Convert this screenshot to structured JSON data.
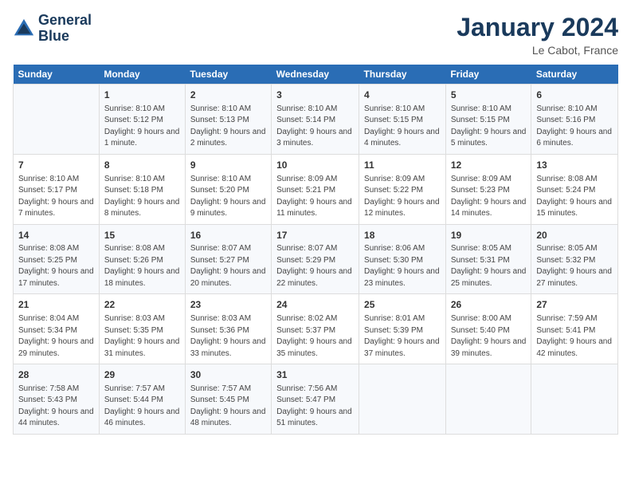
{
  "header": {
    "logo_line1": "General",
    "logo_line2": "Blue",
    "month": "January 2024",
    "location": "Le Cabot, France"
  },
  "weekdays": [
    "Sunday",
    "Monday",
    "Tuesday",
    "Wednesday",
    "Thursday",
    "Friday",
    "Saturday"
  ],
  "weeks": [
    [
      {
        "day": "",
        "sunrise": "",
        "sunset": "",
        "daylight": ""
      },
      {
        "day": "1",
        "sunrise": "Sunrise: 8:10 AM",
        "sunset": "Sunset: 5:12 PM",
        "daylight": "Daylight: 9 hours and 1 minute."
      },
      {
        "day": "2",
        "sunrise": "Sunrise: 8:10 AM",
        "sunset": "Sunset: 5:13 PM",
        "daylight": "Daylight: 9 hours and 2 minutes."
      },
      {
        "day": "3",
        "sunrise": "Sunrise: 8:10 AM",
        "sunset": "Sunset: 5:14 PM",
        "daylight": "Daylight: 9 hours and 3 minutes."
      },
      {
        "day": "4",
        "sunrise": "Sunrise: 8:10 AM",
        "sunset": "Sunset: 5:15 PM",
        "daylight": "Daylight: 9 hours and 4 minutes."
      },
      {
        "day": "5",
        "sunrise": "Sunrise: 8:10 AM",
        "sunset": "Sunset: 5:15 PM",
        "daylight": "Daylight: 9 hours and 5 minutes."
      },
      {
        "day": "6",
        "sunrise": "Sunrise: 8:10 AM",
        "sunset": "Sunset: 5:16 PM",
        "daylight": "Daylight: 9 hours and 6 minutes."
      }
    ],
    [
      {
        "day": "7",
        "sunrise": "Sunrise: 8:10 AM",
        "sunset": "Sunset: 5:17 PM",
        "daylight": "Daylight: 9 hours and 7 minutes."
      },
      {
        "day": "8",
        "sunrise": "Sunrise: 8:10 AM",
        "sunset": "Sunset: 5:18 PM",
        "daylight": "Daylight: 9 hours and 8 minutes."
      },
      {
        "day": "9",
        "sunrise": "Sunrise: 8:10 AM",
        "sunset": "Sunset: 5:20 PM",
        "daylight": "Daylight: 9 hours and 9 minutes."
      },
      {
        "day": "10",
        "sunrise": "Sunrise: 8:09 AM",
        "sunset": "Sunset: 5:21 PM",
        "daylight": "Daylight: 9 hours and 11 minutes."
      },
      {
        "day": "11",
        "sunrise": "Sunrise: 8:09 AM",
        "sunset": "Sunset: 5:22 PM",
        "daylight": "Daylight: 9 hours and 12 minutes."
      },
      {
        "day": "12",
        "sunrise": "Sunrise: 8:09 AM",
        "sunset": "Sunset: 5:23 PM",
        "daylight": "Daylight: 9 hours and 14 minutes."
      },
      {
        "day": "13",
        "sunrise": "Sunrise: 8:08 AM",
        "sunset": "Sunset: 5:24 PM",
        "daylight": "Daylight: 9 hours and 15 minutes."
      }
    ],
    [
      {
        "day": "14",
        "sunrise": "Sunrise: 8:08 AM",
        "sunset": "Sunset: 5:25 PM",
        "daylight": "Daylight: 9 hours and 17 minutes."
      },
      {
        "day": "15",
        "sunrise": "Sunrise: 8:08 AM",
        "sunset": "Sunset: 5:26 PM",
        "daylight": "Daylight: 9 hours and 18 minutes."
      },
      {
        "day": "16",
        "sunrise": "Sunrise: 8:07 AM",
        "sunset": "Sunset: 5:27 PM",
        "daylight": "Daylight: 9 hours and 20 minutes."
      },
      {
        "day": "17",
        "sunrise": "Sunrise: 8:07 AM",
        "sunset": "Sunset: 5:29 PM",
        "daylight": "Daylight: 9 hours and 22 minutes."
      },
      {
        "day": "18",
        "sunrise": "Sunrise: 8:06 AM",
        "sunset": "Sunset: 5:30 PM",
        "daylight": "Daylight: 9 hours and 23 minutes."
      },
      {
        "day": "19",
        "sunrise": "Sunrise: 8:05 AM",
        "sunset": "Sunset: 5:31 PM",
        "daylight": "Daylight: 9 hours and 25 minutes."
      },
      {
        "day": "20",
        "sunrise": "Sunrise: 8:05 AM",
        "sunset": "Sunset: 5:32 PM",
        "daylight": "Daylight: 9 hours and 27 minutes."
      }
    ],
    [
      {
        "day": "21",
        "sunrise": "Sunrise: 8:04 AM",
        "sunset": "Sunset: 5:34 PM",
        "daylight": "Daylight: 9 hours and 29 minutes."
      },
      {
        "day": "22",
        "sunrise": "Sunrise: 8:03 AM",
        "sunset": "Sunset: 5:35 PM",
        "daylight": "Daylight: 9 hours and 31 minutes."
      },
      {
        "day": "23",
        "sunrise": "Sunrise: 8:03 AM",
        "sunset": "Sunset: 5:36 PM",
        "daylight": "Daylight: 9 hours and 33 minutes."
      },
      {
        "day": "24",
        "sunrise": "Sunrise: 8:02 AM",
        "sunset": "Sunset: 5:37 PM",
        "daylight": "Daylight: 9 hours and 35 minutes."
      },
      {
        "day": "25",
        "sunrise": "Sunrise: 8:01 AM",
        "sunset": "Sunset: 5:39 PM",
        "daylight": "Daylight: 9 hours and 37 minutes."
      },
      {
        "day": "26",
        "sunrise": "Sunrise: 8:00 AM",
        "sunset": "Sunset: 5:40 PM",
        "daylight": "Daylight: 9 hours and 39 minutes."
      },
      {
        "day": "27",
        "sunrise": "Sunrise: 7:59 AM",
        "sunset": "Sunset: 5:41 PM",
        "daylight": "Daylight: 9 hours and 42 minutes."
      }
    ],
    [
      {
        "day": "28",
        "sunrise": "Sunrise: 7:58 AM",
        "sunset": "Sunset: 5:43 PM",
        "daylight": "Daylight: 9 hours and 44 minutes."
      },
      {
        "day": "29",
        "sunrise": "Sunrise: 7:57 AM",
        "sunset": "Sunset: 5:44 PM",
        "daylight": "Daylight: 9 hours and 46 minutes."
      },
      {
        "day": "30",
        "sunrise": "Sunrise: 7:57 AM",
        "sunset": "Sunset: 5:45 PM",
        "daylight": "Daylight: 9 hours and 48 minutes."
      },
      {
        "day": "31",
        "sunrise": "Sunrise: 7:56 AM",
        "sunset": "Sunset: 5:47 PM",
        "daylight": "Daylight: 9 hours and 51 minutes."
      },
      {
        "day": "",
        "sunrise": "",
        "sunset": "",
        "daylight": ""
      },
      {
        "day": "",
        "sunrise": "",
        "sunset": "",
        "daylight": ""
      },
      {
        "day": "",
        "sunrise": "",
        "sunset": "",
        "daylight": ""
      }
    ]
  ]
}
